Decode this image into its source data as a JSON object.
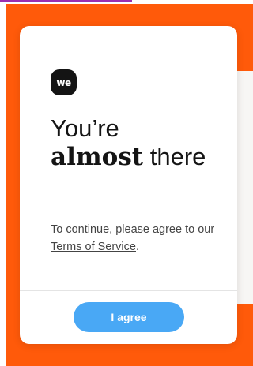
{
  "colors": {
    "background": "#ff5a0a",
    "button": "#49a8f5",
    "logo": "#141414"
  },
  "logo": {
    "text": "we",
    "icon": "we-logo-icon"
  },
  "heading": {
    "line1": "You’re",
    "bold_word": "almost",
    "after_bold": " there"
  },
  "body": {
    "text_before": "To continue, please agree to our ",
    "link_label": "Terms of Service",
    "text_after": "."
  },
  "button": {
    "label": "I agree"
  }
}
